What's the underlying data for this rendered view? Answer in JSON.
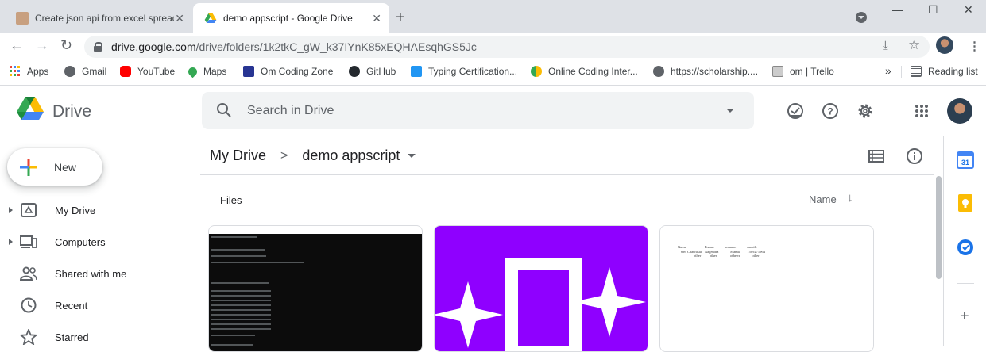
{
  "browser": {
    "tabs": [
      {
        "title": "Create json api from excel spreadsheet",
        "close": "✕"
      },
      {
        "title": "demo appscript - Google Drive",
        "close": "✕"
      }
    ],
    "new_tab": "+",
    "window": {
      "minimize": "—",
      "maximize": "☐",
      "close": "✕"
    },
    "url": {
      "host": "drive.google.com",
      "path": "/drive/folders/1k2tkC_gW_k37IYnK85xEQHAEsqhGS5Jc"
    },
    "bookmarks": [
      {
        "label": "Apps",
        "icon": "apps-grid-icon"
      },
      {
        "label": "Gmail",
        "icon": "globe-icon"
      },
      {
        "label": "YouTube",
        "icon": "youtube-icon"
      },
      {
        "label": "Maps",
        "icon": "maps-pin-icon"
      },
      {
        "label": "Om Coding Zone",
        "icon": "om-coding-zone-icon"
      },
      {
        "label": "GitHub",
        "icon": "github-icon"
      },
      {
        "label": "Typing Certification...",
        "icon": "typing-icon"
      },
      {
        "label": "Online Coding Inter...",
        "icon": "coding-interview-icon"
      },
      {
        "label": "https://scholarship....",
        "icon": "globe-icon"
      },
      {
        "label": "om | Trello",
        "icon": "trello-icon"
      }
    ],
    "bookmarks_more": "»",
    "reading_list": "Reading list"
  },
  "drive": {
    "app_name": "Drive",
    "search_placeholder": "Search in Drive",
    "new_button": "New",
    "nav": [
      {
        "label": "My Drive",
        "icon": "my-drive-icon",
        "expandable": true
      },
      {
        "label": "Computers",
        "icon": "computers-icon",
        "expandable": true
      },
      {
        "label": "Shared with me",
        "icon": "shared-with-me-icon",
        "expandable": false
      },
      {
        "label": "Recent",
        "icon": "recent-clock-icon",
        "expandable": false
      },
      {
        "label": "Starred",
        "icon": "star-icon",
        "expandable": false
      }
    ],
    "breadcrumb": {
      "root": "My Drive",
      "separator": ">",
      "current": "demo appscript"
    },
    "files_label": "Files",
    "sort_label": "Name",
    "files": [
      {
        "thumb": "terminal-thumbnail"
      },
      {
        "thumb": "purple-appscript-thumbnail"
      },
      {
        "thumb": "spreadsheet-thumbnail"
      }
    ],
    "sheet_preview": {
      "headers": [
        "Name",
        "Fname",
        "mname",
        "mobile"
      ],
      "rows": [
        [
          "Om Chaurasia",
          "Nagendra",
          "Mamta",
          "7509271964"
        ],
        [
          "other",
          "other",
          "otherrr",
          "other"
        ]
      ]
    }
  },
  "colors": {
    "accent_blue": "#1a73e8",
    "purple_thumb": "#8f00ff",
    "terminal_bg": "#0c0c0c"
  }
}
